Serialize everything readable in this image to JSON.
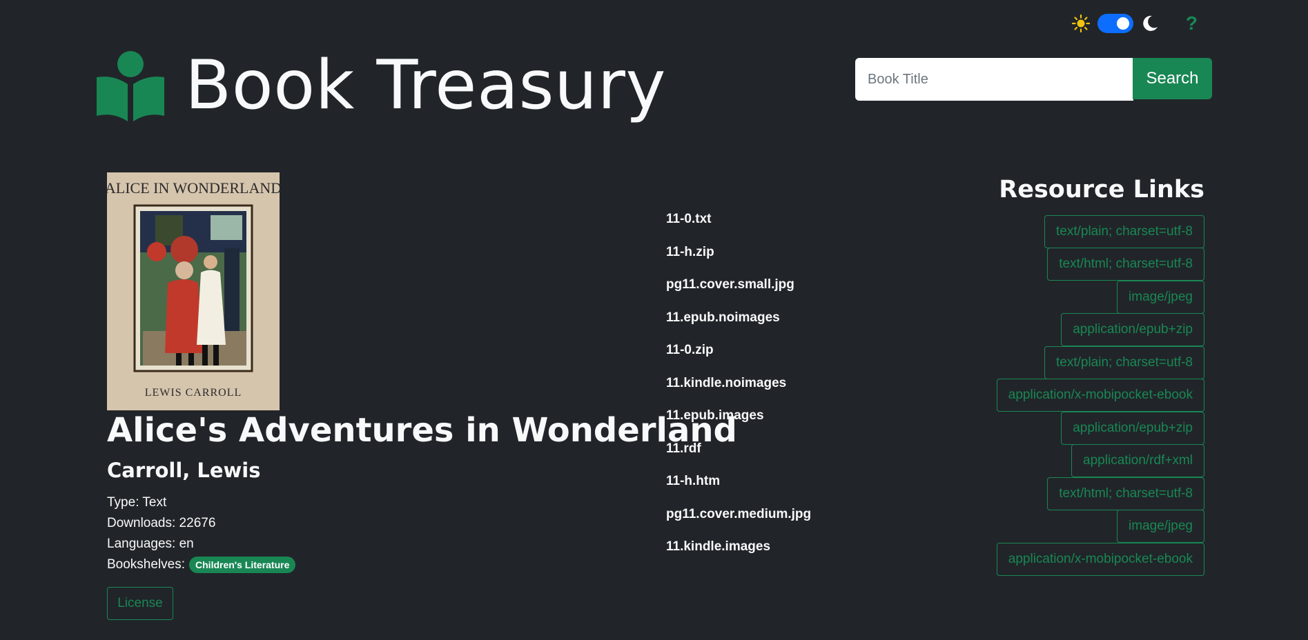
{
  "theme": {
    "light_icon": "sun-icon",
    "dark_icon": "moon-icon",
    "help_label": "?",
    "accent": "#198754",
    "toggle_color": "#0d6efd",
    "sun_color": "#f1c40f"
  },
  "header": {
    "brand_title": "Book Treasury",
    "logo_icon": "reader-book-icon"
  },
  "search": {
    "placeholder": "Book Title",
    "button_label": "Search"
  },
  "book": {
    "cover_title": "ALICE IN WONDERLAND",
    "cover_author": "LEWIS CARROLL",
    "title": "Alice's Adventures in Wonderland",
    "author": "Carroll, Lewis",
    "type_label": "Type: Text",
    "downloads_label": "Downloads: 22676",
    "languages_label": "Languages: en",
    "bookshelves_label": "Bookshelves:",
    "bookshelves": [
      "Children's Literature"
    ],
    "license_label": "License"
  },
  "resources": {
    "heading": "Resource Links",
    "items": [
      {
        "name": "11-0.txt",
        "type": "text/plain; charset=utf-8"
      },
      {
        "name": "11-h.zip",
        "type": "text/html; charset=utf-8"
      },
      {
        "name": "pg11.cover.small.jpg",
        "type": "image/jpeg"
      },
      {
        "name": "11.epub.noimages",
        "type": "application/epub+zip"
      },
      {
        "name": "11-0.zip",
        "type": "text/plain; charset=utf-8"
      },
      {
        "name": "11.kindle.noimages",
        "type": "application/x-mobipocket-ebook"
      },
      {
        "name": "11.epub.images",
        "type": "application/epub+zip"
      },
      {
        "name": "11.rdf",
        "type": "application/rdf+xml"
      },
      {
        "name": "11-h.htm",
        "type": "text/html; charset=utf-8"
      },
      {
        "name": "pg11.cover.medium.jpg",
        "type": "image/jpeg"
      },
      {
        "name": "11.kindle.images",
        "type": "application/x-mobipocket-ebook"
      }
    ]
  }
}
